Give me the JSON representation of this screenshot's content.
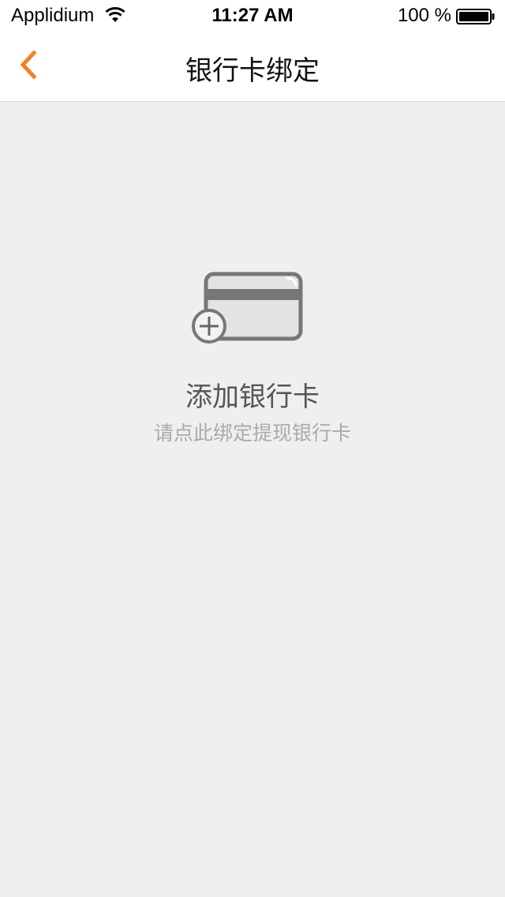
{
  "status_bar": {
    "carrier": "Applidium",
    "time": "11:27 AM",
    "battery": "100 %"
  },
  "nav": {
    "title": "银行卡绑定",
    "back_icon": "chevron-left-icon",
    "accent_color": "#f08322"
  },
  "empty_state": {
    "icon": "add-card-icon",
    "title": "添加银行卡",
    "subtitle": "请点此绑定提现银行卡"
  }
}
